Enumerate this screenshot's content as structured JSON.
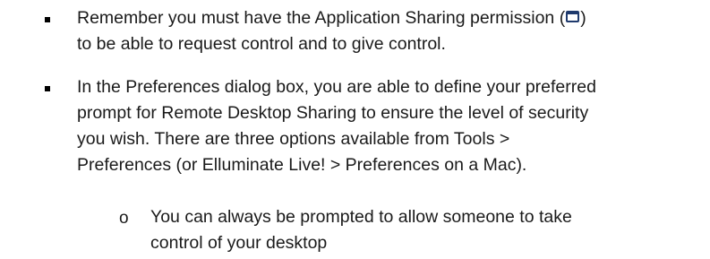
{
  "bullets": [
    {
      "line1_before_icon": "Remember you must have the Application Sharing permission (",
      "line1_after_icon": ")",
      "line2": "to be able to request control and to give control.",
      "icon": "application-sharing-icon"
    },
    {
      "lines": [
        "In the Preferences dialog box, you are able to define your preferred",
        "prompt for Remote Desktop Sharing to ensure the level of security",
        "you wish.  There are three options available from Tools >",
        "Preferences (or Elluminate Live! > Preferences on a Mac)."
      ]
    }
  ],
  "sub_bullets": [
    {
      "marker": "o",
      "lines": [
        "You can always be prompted to allow someone to take",
        "control of your desktop"
      ]
    }
  ]
}
